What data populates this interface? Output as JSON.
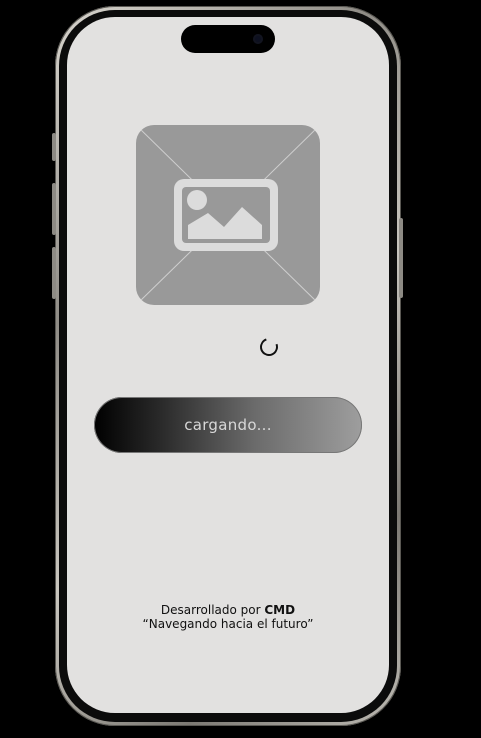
{
  "splash": {
    "image_placeholder_icon": "image-placeholder-icon",
    "loading_text": "cargando...",
    "spinner_icon": "loading-spinner-icon"
  },
  "footer": {
    "developed_by_prefix": "Desarrollado por",
    "developer_name": "CMD",
    "tagline": "“Navegando hacia el futuro”"
  },
  "colors": {
    "screen_bg": "#e2e1e0",
    "placeholder_bg": "#999999",
    "text": "#111111"
  }
}
